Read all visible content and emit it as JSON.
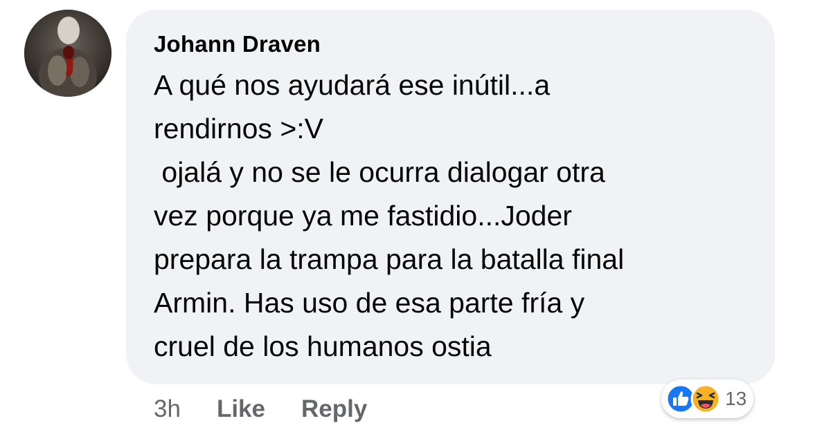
{
  "comment": {
    "author": "Johann Draven",
    "text_lines": [
      "A qué nos ayudará ese inútil...a",
      "rendirnos >:V",
      " ojalá y no se le ocurra dialogar otra",
      "vez porque ya me fastidio...Joder",
      "prepara la trampa para la batalla final",
      "Armin. Has uso de esa parte fría y",
      "cruel de los humanos ostia"
    ],
    "timestamp": "3h",
    "like_label": "Like",
    "reply_label": "Reply"
  },
  "reactions": {
    "icons": [
      "like-icon",
      "haha-icon"
    ],
    "count": "13"
  },
  "colors": {
    "bubble_bg": "#f0f2f5",
    "text": "#050505",
    "meta": "#65676b",
    "like_blue": "#1877f2",
    "haha_yellow": "#f7b125"
  }
}
